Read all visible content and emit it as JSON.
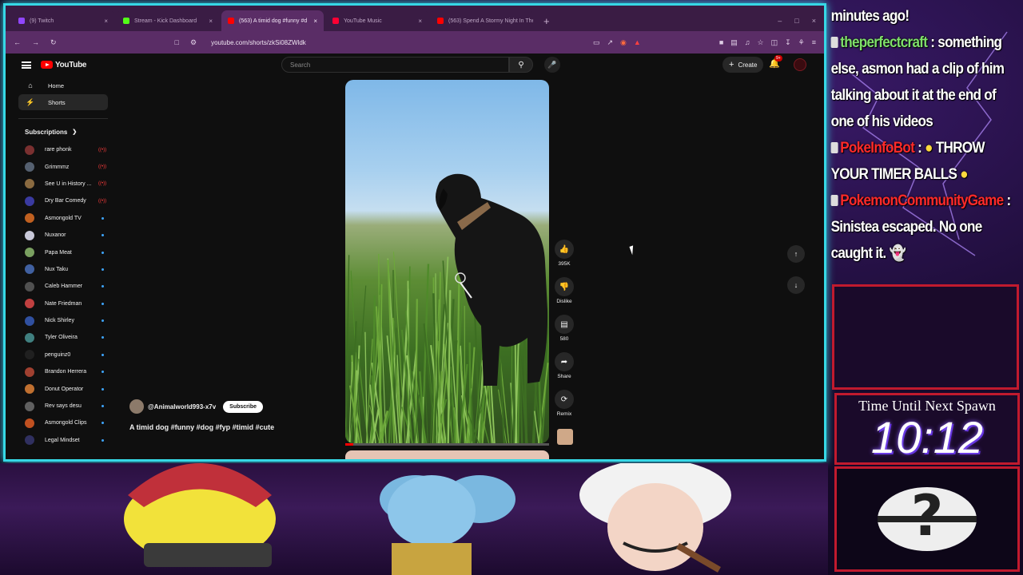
{
  "browser": {
    "tabs": [
      {
        "label": "(9) Twitch",
        "color": "#9146ff"
      },
      {
        "label": "Stream - Kick Dashboard",
        "color": "#53fc18"
      },
      {
        "label": "(563) A timid dog #funny #d",
        "color": "#ff0000",
        "active": true
      },
      {
        "label": "YouTube Music",
        "color": "#ff0033"
      },
      {
        "label": "(563) Spend A Stormy Night In The",
        "color": "#ff0000"
      }
    ],
    "new_tab": "+",
    "url": "youtube.com/shorts/zkSi08ZWldk"
  },
  "youtube": {
    "logo_text": "YouTube",
    "search_placeholder": "Search",
    "create_label": "Create",
    "notification_count": "9+",
    "nav": [
      {
        "label": "Home",
        "icon": "home-icon"
      },
      {
        "label": "Shorts",
        "icon": "shorts-icon",
        "selected": true
      }
    ],
    "subscriptions_label": "Subscriptions",
    "subscriptions": [
      {
        "name": "rare phonk",
        "color": "#7a3030",
        "status": "live"
      },
      {
        "name": "Grimmmz",
        "color": "#556070",
        "status": "live"
      },
      {
        "name": "See U in History ...",
        "color": "#8a6a40",
        "status": "live"
      },
      {
        "name": "Dry Bar Comedy",
        "color": "#3a3aa0",
        "status": "live"
      },
      {
        "name": "Asmongold TV",
        "color": "#c06020",
        "status": "dot"
      },
      {
        "name": "Nuxanor",
        "color": "#c8c8d8",
        "status": "dot"
      },
      {
        "name": "Papa Meat",
        "color": "#7aa060",
        "status": "dot"
      },
      {
        "name": "Nux Taku",
        "color": "#4060a0",
        "status": "dot"
      },
      {
        "name": "Caleb Hammer",
        "color": "#505050",
        "status": "dot"
      },
      {
        "name": "Nate Friedman",
        "color": "#c04040",
        "status": "dot"
      },
      {
        "name": "Nick Shirley",
        "color": "#3050a0",
        "status": "dot"
      },
      {
        "name": "Tyler Oliveira",
        "color": "#408080",
        "status": "dot"
      },
      {
        "name": "penguinz0",
        "color": "#202020",
        "status": "dot"
      },
      {
        "name": "Brandon Herrera",
        "color": "#a04030",
        "status": "dot"
      },
      {
        "name": "Donut Operator",
        "color": "#c07030",
        "status": "dot"
      },
      {
        "name": "Rev says desu",
        "color": "#606060",
        "status": "dot"
      },
      {
        "name": "Asmongold Clips",
        "color": "#c05020",
        "status": "dot"
      },
      {
        "name": "Legal Mindset",
        "color": "#303060",
        "status": "dot"
      }
    ],
    "short": {
      "channel": "@Animalworld993-x7v",
      "subscribe_label": "Subscribe",
      "title": "A timid dog #funny #dog #fyp #timid #cute",
      "progress": 0.04,
      "likes": "395K",
      "dislike_label": "Dislike",
      "comments": "580",
      "share_label": "Share",
      "remix_label": "Remix"
    }
  },
  "chat": [
    {
      "text": "minutes ago!"
    },
    {
      "user": "theperfectcraft",
      "user_color": "#7fe06a",
      "message": "something else, asmon had a clip of him talking about it at the end of one of his videos"
    },
    {
      "user": "PokeInfoBot",
      "user_color": "#ff2a2a",
      "message": "THROW YOUR TIMER BALLS"
    },
    {
      "user": "PokemonCommunityGame",
      "user_color": "#ff2a2a",
      "message": ": Sinistea escaped. No one caught it."
    }
  ],
  "overlay": {
    "timer_label": "Time Until Next Spawn",
    "timer_value": "10:12",
    "accent": "#36d8e6",
    "frame_color": "#c11a2e"
  }
}
